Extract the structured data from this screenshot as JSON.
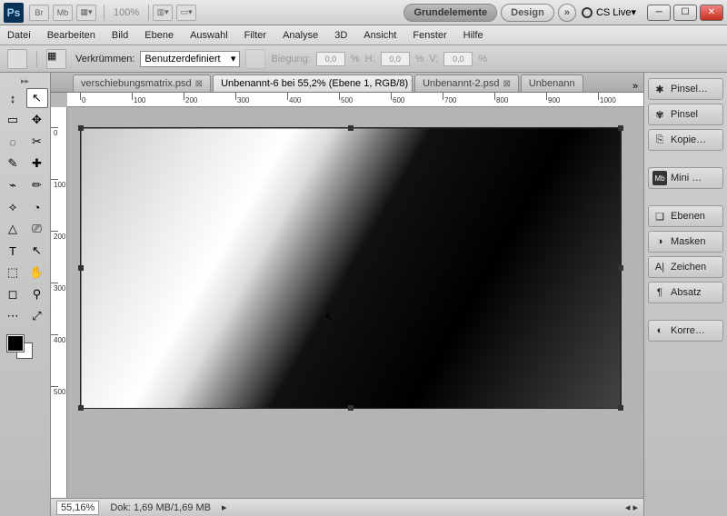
{
  "titlebar": {
    "logo": "Ps",
    "btn_br": "Br",
    "btn_mb": "Mb",
    "zoom": "100%",
    "workspace_active": "Grundelemente",
    "workspace_design": "Design",
    "more": "»",
    "cslive": "CS Live"
  },
  "menu": [
    "Datei",
    "Bearbeiten",
    "Bild",
    "Ebene",
    "Auswahl",
    "Filter",
    "Analyse",
    "3D",
    "Ansicht",
    "Fenster",
    "Hilfe"
  ],
  "options": {
    "verkruemmen": "Verkrümmen:",
    "preset": "Benutzerdefiniert",
    "biegung": "Biegung:",
    "b_val": "0,0",
    "h": "H:",
    "h_val": "0,0",
    "v": "V:",
    "v_val": "0,0",
    "pct": "%"
  },
  "tabs": [
    {
      "label": "verschiebungsmatrix.psd"
    },
    {
      "label": "Unbenannt-6 bei 55,2% (Ebene 1, RGB/8) *"
    },
    {
      "label": "Unbenannt-2.psd"
    },
    {
      "label": "Unbenann"
    }
  ],
  "tabs_more": "»",
  "ruler_h_ticks": [
    0,
    100,
    200,
    300,
    400,
    500,
    600,
    700,
    800,
    900,
    1000
  ],
  "ruler_v_ticks": [
    0,
    100,
    200,
    300,
    400,
    500
  ],
  "status": {
    "zoom": "55,16%",
    "doc": "Dok: 1,69 MB/1,69 MB"
  },
  "panels": {
    "pinsel1": "Pinsel…",
    "pinsel2": "Pinsel",
    "kopie": "Kopie…",
    "mini": "Mini …",
    "mini_badge": "Mb",
    "ebenen": "Ebenen",
    "masken": "Masken",
    "zeichen": "Zeichen",
    "absatz": "Absatz",
    "korre": "Korre…"
  },
  "tools": [
    "↕",
    "↖",
    "▭",
    "✥",
    "◌",
    "✂",
    "✎",
    "✚",
    "⌁",
    "✏",
    "⟡",
    "◔",
    "△",
    "⎚",
    "T",
    "↖",
    "⬚",
    "✋",
    "◻",
    "⚲",
    "⋯",
    "⤢"
  ]
}
